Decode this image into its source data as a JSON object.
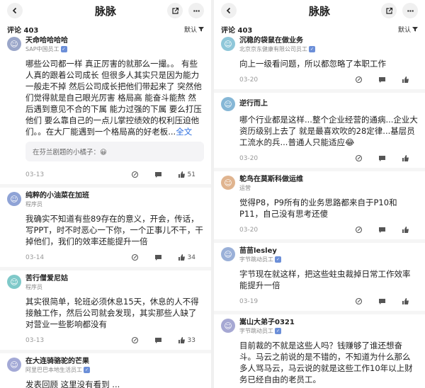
{
  "colors": {
    "accent": "#2b6ee0",
    "badge": "#6c8fd8",
    "text": "#222222",
    "muted": "#999999"
  },
  "left": {
    "header": {
      "title": "脉脉"
    },
    "subbar": {
      "count": "评论 403",
      "sort": "默认"
    },
    "comments": [
      {
        "name": "天命哈哈哈哈",
        "role": "SAP中国员工",
        "text": "哪些公司都一样 真正厉害的就那么一撮。。 有些人真的跟着公司成长 但很多人其实只是因为能力一般走不掉 然后公司成长把他们带起来了 突然他们觉得就是自己眼光厉害 格局高 能奋斗能熬 然后遇到意见不合的下属 能力过强的下属 要么打压他们 要么靠自己的一点儿掌控绩效的权利压迫他们。。在大厂能遇到一个格局高的好老板...",
        "more": "全文",
        "quote": "在芬兰剧题的小橘子：😀",
        "date": "03-13",
        "likes": "51"
      },
      {
        "name": "纯粹的小油菜在加班",
        "role": "程序员",
        "text": "我确实不知道有些89存在的意义，开会，传话，写PPT，时不时恶心一下你，一个正事儿不干，干掉他们，我们的效率还能提升一倍",
        "date": "03-14",
        "likes": "34"
      },
      {
        "name": "苦行僧爱尼姑",
        "role": "程序员",
        "text": "其实很简单，轮班必须休息15天，休息的人不得接触工作，然后公司就会发现，其实那些人缺了对营业一些影响都没有",
        "date": "03-13",
        "likes": "33"
      },
      {
        "name": "在大连骑骆驼的芒果",
        "role": "阿里巴巴本地生活员工",
        "text": "发表回顾 这里没有看到 ..."
      }
    ]
  },
  "right": {
    "header": {
      "title": "脉脉"
    },
    "subbar": {
      "count": "评论 403",
      "sort": "默认"
    },
    "comments": [
      {
        "name": "沉稳的袋鼠在做业务",
        "role": "北京京东健康有限公司员工",
        "text": "向上一级看问题，所以都忽略了本职工作",
        "date": "03-20"
      },
      {
        "name": "逆行而上",
        "role": "",
        "text": "哪个行业都是这样...整个企业经营的通病...企业大资历级别上去了 就是最喜欢吹的28定律...基层员工流水的兵...普通人只能适应😂",
        "date": "03-20"
      },
      {
        "name": "鸵鸟在莫斯科做运维",
        "role": "运营",
        "text": "觉得P8，P9所有的业务思路都来自于P10和P11，自己没有思考还傻",
        "date": "03-20"
      },
      {
        "name": "苗苗lesley",
        "role": "字节跳动员工",
        "text": "字节现在就这样，把这些蛀虫裁掉日常工作效率能提升一倍",
        "date": "03-19"
      },
      {
        "name": "嵩山大弟子0321",
        "role": "字节跳动员工",
        "text": "目前裁的不就是这些人吗？钱赚够了谁还想奋斗。马云之前说的是不错的，不知道为什么那么多人骂马云，马云说的就是这些工作10年以上财务已经自由的老员工。"
      }
    ]
  }
}
